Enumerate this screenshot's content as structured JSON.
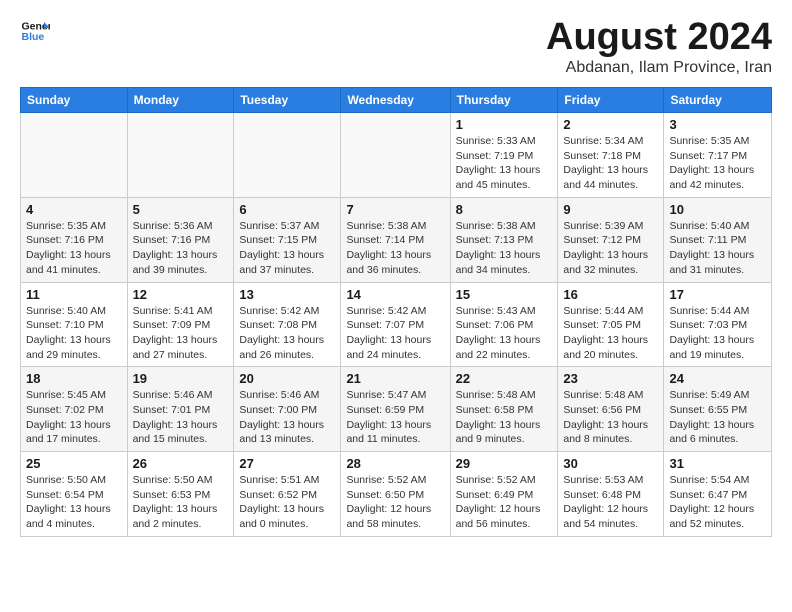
{
  "logo": {
    "line1": "General",
    "line2": "Blue"
  },
  "title": "August 2024",
  "subtitle": "Abdanan, Ilam Province, Iran",
  "days_of_week": [
    "Sunday",
    "Monday",
    "Tuesday",
    "Wednesday",
    "Thursday",
    "Friday",
    "Saturday"
  ],
  "weeks": [
    [
      {
        "day": "",
        "detail": ""
      },
      {
        "day": "",
        "detail": ""
      },
      {
        "day": "",
        "detail": ""
      },
      {
        "day": "",
        "detail": ""
      },
      {
        "day": "1",
        "detail": "Sunrise: 5:33 AM\nSunset: 7:19 PM\nDaylight: 13 hours\nand 45 minutes."
      },
      {
        "day": "2",
        "detail": "Sunrise: 5:34 AM\nSunset: 7:18 PM\nDaylight: 13 hours\nand 44 minutes."
      },
      {
        "day": "3",
        "detail": "Sunrise: 5:35 AM\nSunset: 7:17 PM\nDaylight: 13 hours\nand 42 minutes."
      }
    ],
    [
      {
        "day": "4",
        "detail": "Sunrise: 5:35 AM\nSunset: 7:16 PM\nDaylight: 13 hours\nand 41 minutes."
      },
      {
        "day": "5",
        "detail": "Sunrise: 5:36 AM\nSunset: 7:16 PM\nDaylight: 13 hours\nand 39 minutes."
      },
      {
        "day": "6",
        "detail": "Sunrise: 5:37 AM\nSunset: 7:15 PM\nDaylight: 13 hours\nand 37 minutes."
      },
      {
        "day": "7",
        "detail": "Sunrise: 5:38 AM\nSunset: 7:14 PM\nDaylight: 13 hours\nand 36 minutes."
      },
      {
        "day": "8",
        "detail": "Sunrise: 5:38 AM\nSunset: 7:13 PM\nDaylight: 13 hours\nand 34 minutes."
      },
      {
        "day": "9",
        "detail": "Sunrise: 5:39 AM\nSunset: 7:12 PM\nDaylight: 13 hours\nand 32 minutes."
      },
      {
        "day": "10",
        "detail": "Sunrise: 5:40 AM\nSunset: 7:11 PM\nDaylight: 13 hours\nand 31 minutes."
      }
    ],
    [
      {
        "day": "11",
        "detail": "Sunrise: 5:40 AM\nSunset: 7:10 PM\nDaylight: 13 hours\nand 29 minutes."
      },
      {
        "day": "12",
        "detail": "Sunrise: 5:41 AM\nSunset: 7:09 PM\nDaylight: 13 hours\nand 27 minutes."
      },
      {
        "day": "13",
        "detail": "Sunrise: 5:42 AM\nSunset: 7:08 PM\nDaylight: 13 hours\nand 26 minutes."
      },
      {
        "day": "14",
        "detail": "Sunrise: 5:42 AM\nSunset: 7:07 PM\nDaylight: 13 hours\nand 24 minutes."
      },
      {
        "day": "15",
        "detail": "Sunrise: 5:43 AM\nSunset: 7:06 PM\nDaylight: 13 hours\nand 22 minutes."
      },
      {
        "day": "16",
        "detail": "Sunrise: 5:44 AM\nSunset: 7:05 PM\nDaylight: 13 hours\nand 20 minutes."
      },
      {
        "day": "17",
        "detail": "Sunrise: 5:44 AM\nSunset: 7:03 PM\nDaylight: 13 hours\nand 19 minutes."
      }
    ],
    [
      {
        "day": "18",
        "detail": "Sunrise: 5:45 AM\nSunset: 7:02 PM\nDaylight: 13 hours\nand 17 minutes."
      },
      {
        "day": "19",
        "detail": "Sunrise: 5:46 AM\nSunset: 7:01 PM\nDaylight: 13 hours\nand 15 minutes."
      },
      {
        "day": "20",
        "detail": "Sunrise: 5:46 AM\nSunset: 7:00 PM\nDaylight: 13 hours\nand 13 minutes."
      },
      {
        "day": "21",
        "detail": "Sunrise: 5:47 AM\nSunset: 6:59 PM\nDaylight: 13 hours\nand 11 minutes."
      },
      {
        "day": "22",
        "detail": "Sunrise: 5:48 AM\nSunset: 6:58 PM\nDaylight: 13 hours\nand 9 minutes."
      },
      {
        "day": "23",
        "detail": "Sunrise: 5:48 AM\nSunset: 6:56 PM\nDaylight: 13 hours\nand 8 minutes."
      },
      {
        "day": "24",
        "detail": "Sunrise: 5:49 AM\nSunset: 6:55 PM\nDaylight: 13 hours\nand 6 minutes."
      }
    ],
    [
      {
        "day": "25",
        "detail": "Sunrise: 5:50 AM\nSunset: 6:54 PM\nDaylight: 13 hours\nand 4 minutes."
      },
      {
        "day": "26",
        "detail": "Sunrise: 5:50 AM\nSunset: 6:53 PM\nDaylight: 13 hours\nand 2 minutes."
      },
      {
        "day": "27",
        "detail": "Sunrise: 5:51 AM\nSunset: 6:52 PM\nDaylight: 13 hours\nand 0 minutes."
      },
      {
        "day": "28",
        "detail": "Sunrise: 5:52 AM\nSunset: 6:50 PM\nDaylight: 12 hours\nand 58 minutes."
      },
      {
        "day": "29",
        "detail": "Sunrise: 5:52 AM\nSunset: 6:49 PM\nDaylight: 12 hours\nand 56 minutes."
      },
      {
        "day": "30",
        "detail": "Sunrise: 5:53 AM\nSunset: 6:48 PM\nDaylight: 12 hours\nand 54 minutes."
      },
      {
        "day": "31",
        "detail": "Sunrise: 5:54 AM\nSunset: 6:47 PM\nDaylight: 12 hours\nand 52 minutes."
      }
    ]
  ]
}
